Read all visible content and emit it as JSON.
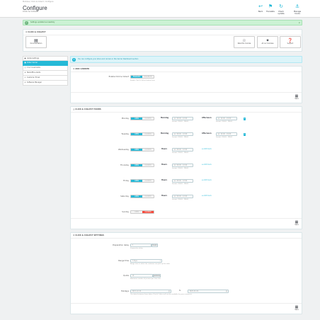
{
  "header": {
    "breadcrumb": "Modules  /  Click & Collect  /  Configure",
    "title": "Configure",
    "subtitle": "Click & Collect",
    "toolbar": [
      {
        "label": "Back",
        "icon": "back-icon"
      },
      {
        "label": "Translate",
        "icon": "flag-icon"
      },
      {
        "label": "Check update",
        "icon": "refresh-icon"
      },
      {
        "label": "Manage hooks",
        "icon": "anchor-icon"
      }
    ]
  },
  "alert": {
    "text": "Settings updated successfully",
    "close": "×"
  },
  "quick_panel": {
    "title": "CLICK & COLLECT",
    "buttons": [
      {
        "label": "Documentation",
        "icon": "book-icon"
      },
      {
        "label": "Rate this module",
        "icon": "star-icon"
      },
      {
        "label": "All our modules",
        "icon": "puzzle-icon"
      },
      {
        "label": "Support",
        "icon": "help-icon"
      }
    ]
  },
  "sidebar": {
    "items": [
      {
        "label": "Global settings",
        "icon": "globe-icon"
      },
      {
        "label": "Order Carrier",
        "icon": "truck-icon",
        "active": true
      },
      {
        "label": "C & C Load slots",
        "icon": "clock-icon"
      },
      {
        "label": "Backoffice Alerts",
        "icon": "bell-icon"
      },
      {
        "label": "Customer Email",
        "icon": "mail-icon"
      },
      {
        "label": "Software Manager",
        "icon": "cog-icon"
      }
    ]
  },
  "info": {
    "text": "You can configure your store and carriers in the Carrier Dashboard section"
  },
  "panel_add_carrier": {
    "title": "ADD CARRIER",
    "field_label": "Enable Click & Collect",
    "help": "Enable Click & Collect feature here",
    "yes": "ENABLED",
    "no": "DISABLED",
    "save": "Save"
  },
  "panel_hours": {
    "title": "CLICK & COLLECT HOURS",
    "yes": "OPEN",
    "no": "CLOSED",
    "morning": "Morning",
    "afternoon": "Afternoon",
    "hours": "Hours",
    "placeholder": "ex: 09:00 - 12:00",
    "placeholder_pm": "ex: 14:00 - 19:00",
    "hint": "Format: 09h00 - 18h00",
    "add_label": "Add hours",
    "days": [
      {
        "name": "Monday",
        "open": true,
        "split": true
      },
      {
        "name": "Tuesday",
        "open": true,
        "split": true
      },
      {
        "name": "Wednesday",
        "open": true,
        "split": false
      },
      {
        "name": "Thursday",
        "open": true,
        "split": false
      },
      {
        "name": "Friday",
        "open": true,
        "split": false
      },
      {
        "name": "Saturday",
        "open": true,
        "split": false
      },
      {
        "name": "Sunday",
        "open": false,
        "split": false
      }
    ],
    "save": "Save"
  },
  "panel_settings": {
    "title": "CLICK & COLLECT SETTINGS",
    "prep_label": "Preparation delay",
    "prep_value": "2",
    "prep_unit": "hours",
    "prep_help": "Preparation delay",
    "range_label": "Range time",
    "range_value": "7 days",
    "range_help": "Range time in which the customer can pick up his order",
    "quota_label": "Quota",
    "quota_value": "10",
    "quota_unit": "persons",
    "quota_help": "Maximum number of persons per time slot",
    "holidays_label": "Holidays",
    "from_ph": "2021-12-24",
    "to_ph": "2022-01-02",
    "and": "to",
    "holidays_help": "The dates between these dates Click & Collect will not be available for your customers",
    "save": "Save"
  }
}
